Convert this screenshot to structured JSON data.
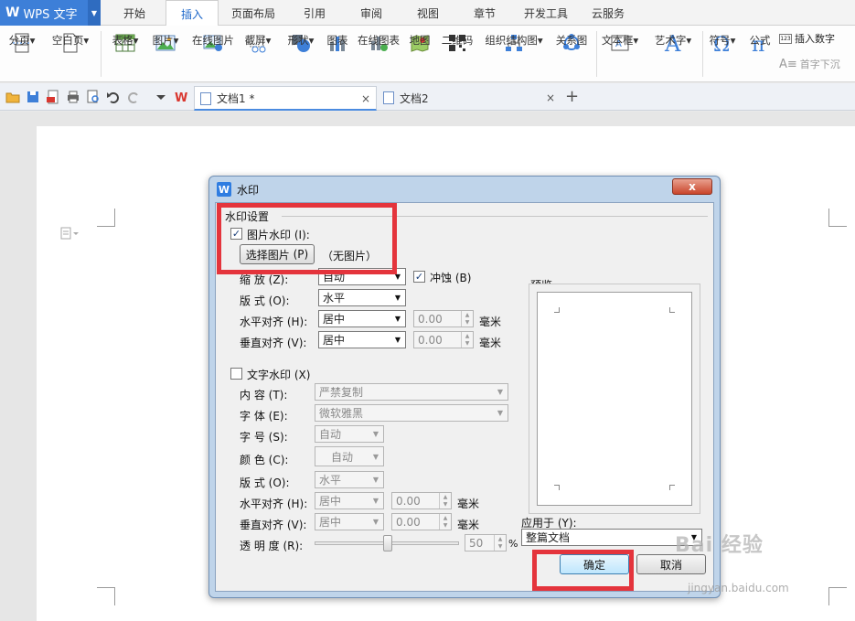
{
  "app": {
    "name": "WPS 文字",
    "logo": "W"
  },
  "menu_tabs": [
    "开始",
    "插入",
    "页面布局",
    "引用",
    "审阅",
    "视图",
    "章节",
    "开发工具",
    "云服务"
  ],
  "ribbon": {
    "items": [
      "分页",
      "空白页",
      "表格",
      "图片",
      "在线图片",
      "截屏",
      "形状",
      "图表",
      "在线图表",
      "地图",
      "二维码",
      "组织结构图",
      "关系图",
      "文本框",
      "艺术字",
      "符号",
      "公式"
    ],
    "insert_number": "插入数字",
    "drop_cap": "首字下沉"
  },
  "doc_tabs": [
    {
      "title": "文档1 *",
      "close": "×"
    },
    {
      "title": "文档2",
      "close": "×"
    }
  ],
  "new_tab": "+",
  "dialog": {
    "title": "水印",
    "close_label": "x",
    "section_settings": "水印设置",
    "picture_wm": {
      "label": "图片水印",
      "accel": "(I):",
      "checked": true,
      "select_button": "选择图片",
      "select_accel": "(P)",
      "status": "（无图片）",
      "scale_label": "缩   放",
      "scale_accel": "(Z):",
      "scale_value": "自动",
      "washout_label": "冲蚀",
      "washout_accel": "(B)",
      "washout_checked": true,
      "layout_label": "版   式",
      "layout_accel": "(O):",
      "layout_value": "水平",
      "halign_label": "水平对齐",
      "halign_accel": "(H):",
      "halign_value": "居中",
      "halign_offset": "0.00",
      "valign_label": "垂直对齐",
      "valign_accel": "(V):",
      "valign_value": "居中",
      "valign_offset": "0.00",
      "unit": "毫米"
    },
    "text_wm": {
      "label": "文字水印",
      "accel": "(X)",
      "checked": false,
      "content_label": "内   容",
      "content_accel": "(T):",
      "content_value": "严禁复制",
      "font_label": "字   体",
      "font_accel": "(E):",
      "font_value": "微软雅黑",
      "size_label": "字   号",
      "size_accel": "(S):",
      "size_value": "自动",
      "color_label": "颜   色",
      "color_accel": "(C):",
      "color_value": "自动",
      "layout_label": "版   式",
      "layout_accel": "(O):",
      "layout_value": "水平",
      "halign_label": "水平对齐",
      "halign_accel": "(H):",
      "halign_value": "居中",
      "halign_offset": "0.00",
      "valign_label": "垂直对齐",
      "valign_accel": "(V):",
      "valign_value": "居中",
      "valign_offset": "0.00",
      "unit": "毫米",
      "transparency_label": "透 明 度",
      "transparency_accel": "(R):",
      "transparency_value": "50",
      "transparency_unit": "%"
    },
    "preview_label": "预览",
    "apply_label": "应用于",
    "apply_accel": "(Y):",
    "apply_value": "整篇文档",
    "ok_button": "确定",
    "cancel_button": "取消"
  },
  "overlay_watermark": {
    "brand": "Bai 经验",
    "url": "jingyan.baidu.com"
  },
  "colors": {
    "accent": "#3d7fd8",
    "highlight": "#e4343c"
  }
}
